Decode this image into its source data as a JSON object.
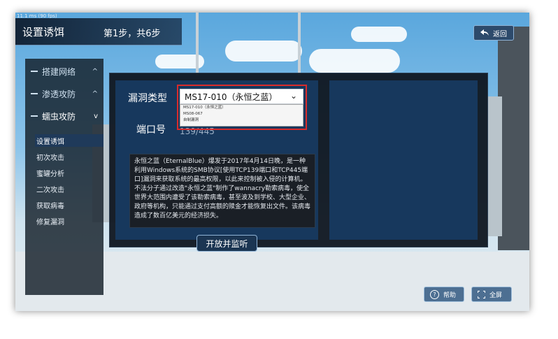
{
  "overlay": {
    "fps_text": "11.1 ms (90 fps)"
  },
  "topbar": {
    "title": "设置诱饵",
    "step": "第1步，共6步",
    "back_label": "返回"
  },
  "sidebar": {
    "items": [
      {
        "label": "搭建网络",
        "caret": "^"
      },
      {
        "label": "渗透攻防",
        "caret": "^"
      },
      {
        "label": "蠕虫攻防",
        "caret": "v"
      }
    ],
    "subitems": [
      {
        "label": "设置诱饵"
      },
      {
        "label": "初次攻击"
      },
      {
        "label": "蜜罐分析"
      },
      {
        "label": "二次攻击"
      },
      {
        "label": "获取病毒"
      },
      {
        "label": "修复漏洞"
      }
    ]
  },
  "form": {
    "vuln_label": "漏洞类型",
    "vuln_value": "MS17-010（永恒之蓝）",
    "dropdown_options": [
      "MS17-010（永恒之蓝）",
      "MS08-067",
      "自制漏洞"
    ],
    "port_label": "端口号",
    "port_value": "139/445",
    "description": "永恒之蓝（EternalBlue）爆发于2017年4月14日晚，是一种利用Windows系统的SMB协议[使用TCP139端口和TCP445端口]漏洞来获取系统的最高权限，以此来控制被入侵的计算机。不法分子通过改造\"永恒之蓝\"制作了wannacry勒索病毒，使全世界大范围内遭受了该勒索病毒，甚至波及到学校、大型企业、政府等机构，只能通过支付高额的赎金才能恢复出文件。该病毒造成了数百亿美元的经济损失。",
    "action_button": "开放并监听"
  },
  "footer": {
    "help_label": "帮助",
    "fullscreen_label": "全屏"
  },
  "colors": {
    "accent_red": "#d92b2b",
    "panel_blue": "#17385d"
  }
}
